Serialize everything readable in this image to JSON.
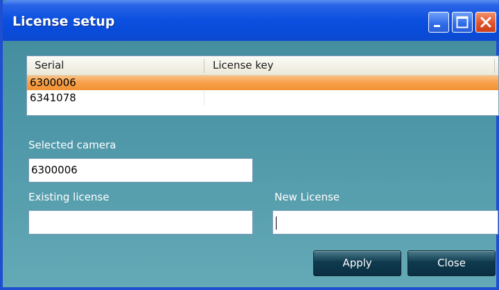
{
  "window": {
    "title": "License setup"
  },
  "title_buttons": {
    "minimize": "minimize-icon",
    "maximize": "maximize-icon",
    "close": "close-icon"
  },
  "list": {
    "columns": [
      "Serial",
      "License key"
    ],
    "rows": [
      {
        "serial": "6300006",
        "license_key": "",
        "selected": true
      },
      {
        "serial": "6341078",
        "license_key": "",
        "selected": false
      }
    ]
  },
  "form": {
    "selected_camera_label": "Selected camera",
    "selected_camera_value": "6300006",
    "existing_license_label": "Existing license",
    "existing_license_value": "",
    "new_license_label": "New License",
    "new_license_value": ""
  },
  "buttons": {
    "apply": "Apply",
    "close": "Close"
  },
  "colors": {
    "title_blue": "#0a4fe0",
    "selection_orange": "#f7a04a",
    "teal_background": "#4e97a8",
    "dark_button": "#0f3a4e"
  }
}
